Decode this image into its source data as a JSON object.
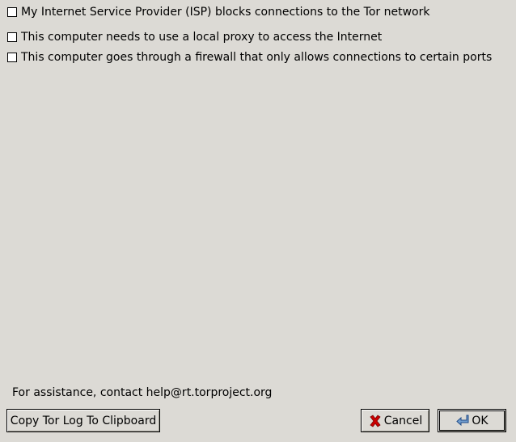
{
  "options": [
    {
      "label": "My Internet Service Provider (ISP) blocks connections to the Tor network",
      "checked": false
    },
    {
      "label": "This computer needs to use a local proxy to access the Internet",
      "checked": false
    },
    {
      "label": "This computer goes through a firewall that only allows connections to certain ports",
      "checked": false
    }
  ],
  "assistance_text": "For assistance, contact help@rt.torproject.org",
  "buttons": {
    "copy_log": "Copy Tor Log To Clipboard",
    "cancel": "Cancel",
    "ok": "OK"
  },
  "icons": {
    "cancel": "cancel-x-icon",
    "ok": "enter-arrow-icon"
  },
  "colors": {
    "background": "#dcdad5",
    "cancel_icon": "#cc0000",
    "ok_icon": "#3465a4"
  }
}
